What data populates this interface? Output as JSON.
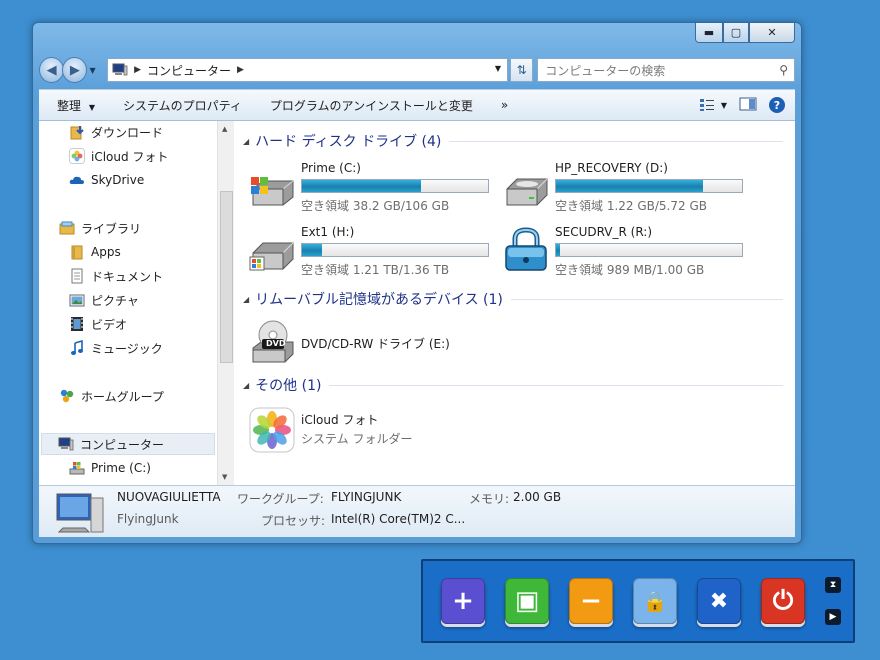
{
  "window": {
    "caption": {
      "minimize": "▬",
      "maximize": "▢",
      "close": "✕"
    }
  },
  "navbar": {
    "back_icon": "back-arrow-icon",
    "forward_icon": "forward-arrow-icon",
    "breadcrumb": "コンピューター",
    "search_placeholder": "コンピューターの検索"
  },
  "toolbar": {
    "organize": "整理",
    "system_properties": "システムのプロパティ",
    "uninstall": "プログラムのアンインストールと変更",
    "more": "»"
  },
  "nav_pane": {
    "items": [
      {
        "label": "ダウンロード",
        "icon": "downloads-folder-icon"
      },
      {
        "label": "iCloud フォト",
        "icon": "icloud-photos-icon"
      },
      {
        "label": "SkyDrive",
        "icon": "skydrive-cloud-icon"
      },
      {
        "label": "ライブラリ",
        "icon": "libraries-icon"
      },
      {
        "label": "Apps",
        "icon": "folder-icon"
      },
      {
        "label": "ドキュメント",
        "icon": "documents-icon"
      },
      {
        "label": "ピクチャ",
        "icon": "pictures-icon"
      },
      {
        "label": "ビデオ",
        "icon": "videos-icon"
      },
      {
        "label": "ミュージック",
        "icon": "music-icon"
      },
      {
        "label": "ホームグループ",
        "icon": "homegroup-icon"
      },
      {
        "label": "コンピューター",
        "icon": "computer-icon"
      },
      {
        "label": "Prime (C:)",
        "icon": "windows-drive-icon"
      }
    ]
  },
  "groups": {
    "hdd": "ハード ディスク ドライブ (4)",
    "removable": "リムーバブル記憶域があるデバイス (1)",
    "other": "その他 (1)"
  },
  "drives": [
    {
      "name": "Prime (C:)",
      "free": "空き領域 38.2 GB/106 GB",
      "used_fraction": 0.64
    },
    {
      "name": "HP_RECOVERY (D:)",
      "free": "空き領域 1.22 GB/5.72 GB",
      "used_fraction": 0.79
    },
    {
      "name": "Ext1 (H:)",
      "free": "空き領域 1.21 TB/1.36 TB",
      "used_fraction": 0.11
    },
    {
      "name": "SECUDRV_R (R:)",
      "free": "空き領域 989 MB/1.00 GB",
      "used_fraction": 0.02
    }
  ],
  "dvd": {
    "name": "DVD/CD-RW ドライブ (E:)",
    "icon_text": "DVD"
  },
  "other_item": {
    "name": "iCloud フォト",
    "subtitle": "システム フォルダー"
  },
  "details": {
    "computer_name": "NUOVAGIULIETTA",
    "user": "FlyingJunk",
    "workgroup_label": "ワークグループ:",
    "workgroup": "FLYINGJUNK",
    "memory_label": "メモリ:",
    "memory": "2.00 GB",
    "processor_label": "プロセッサ:",
    "processor": "Intel(R) Core(TM)2 C..."
  },
  "gadget": {
    "buttons": [
      {
        "icon": "plus-icon",
        "glyph": "+",
        "color": "#5a4fd0"
      },
      {
        "icon": "monitor-icon",
        "glyph": "▣",
        "color": "#3fb83a"
      },
      {
        "icon": "minus-icon",
        "glyph": "−",
        "color": "#f29a12"
      },
      {
        "icon": "lock-icon",
        "glyph": "🔒",
        "color": "#7ab4ea"
      },
      {
        "icon": "tools-icon",
        "glyph": "✖",
        "color": "#1f63c8"
      },
      {
        "icon": "power-icon",
        "glyph": "⏻",
        "color": "#d83524"
      }
    ],
    "hourglass": "⧗",
    "play": "▶"
  }
}
